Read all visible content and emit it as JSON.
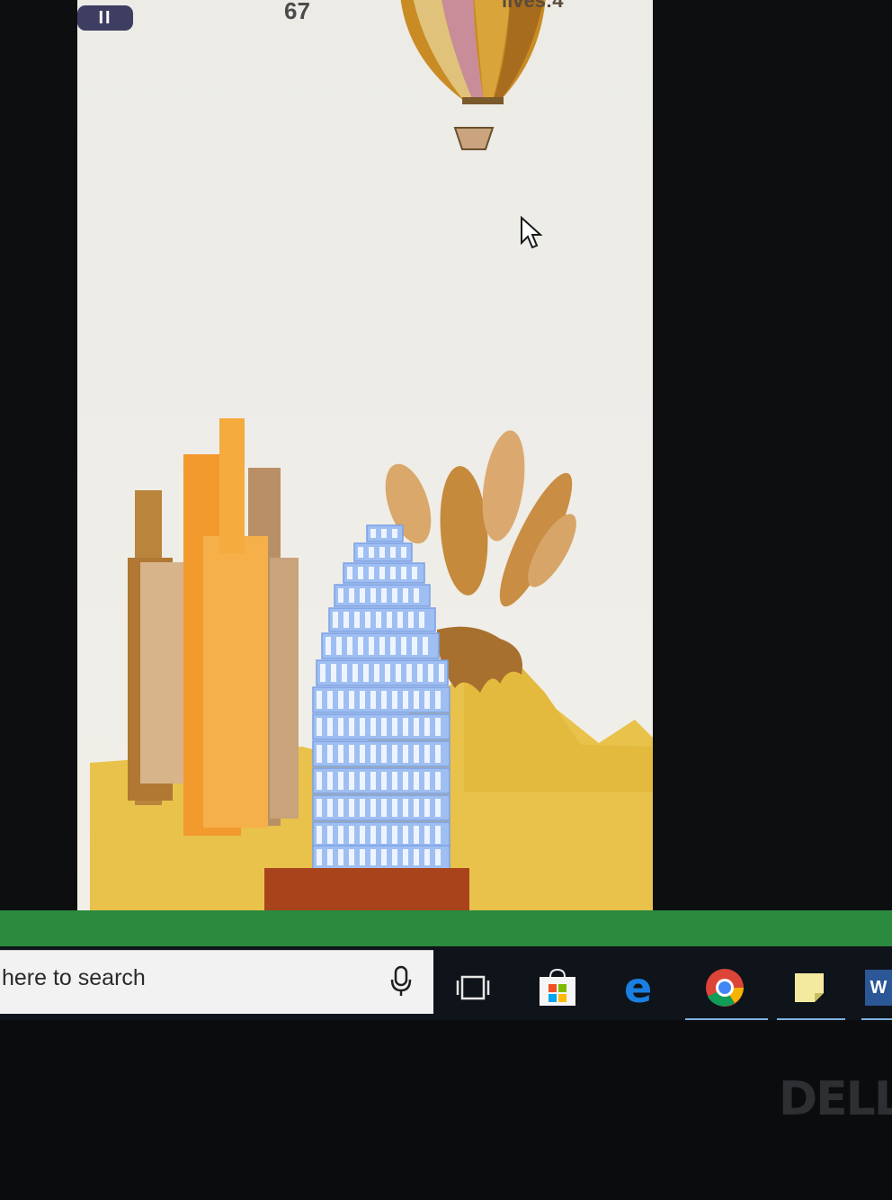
{
  "game": {
    "score": "67",
    "lives": "lives:4",
    "pause_label": "II"
  },
  "taskbar": {
    "search_placeholder": "here to search",
    "apps": [
      {
        "name": "task-view",
        "icon": "task-view-icon"
      },
      {
        "name": "store",
        "icon": "microsoft-store-icon"
      },
      {
        "name": "edge",
        "icon": "edge-icon"
      },
      {
        "name": "chrome",
        "icon": "chrome-icon"
      },
      {
        "name": "sticky-notes",
        "icon": "sticky-notes-icon"
      },
      {
        "name": "word",
        "icon": "word-icon",
        "label": "W"
      }
    ]
  },
  "monitor": {
    "brand": "DELL"
  },
  "colors": {
    "accent_green": "#2b8a3e",
    "tower_blue": "#9fbff2",
    "sand": "#e8c24a"
  }
}
